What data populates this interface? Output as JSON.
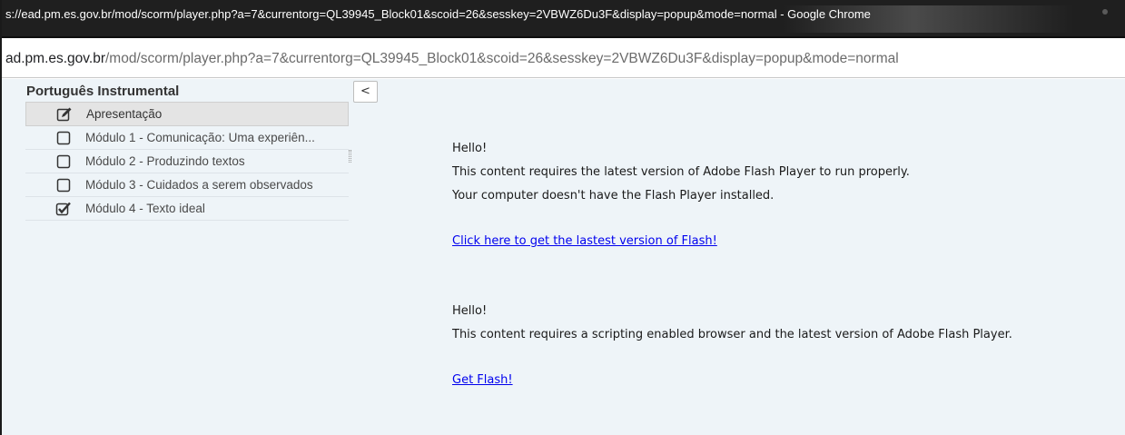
{
  "window": {
    "title": "s://ead.pm.es.gov.br/mod/scorm/player.php?a=7&currentorg=QL39945_Block01&scoid=26&sesskey=2VBWZ6Du3F&display=popup&mode=normal - Google Chrome"
  },
  "address_bar": {
    "host": "ad.pm.es.gov.br",
    "path": "/mod/scorm/player.php?a=7&currentorg=QL39945_Block01&scoid=26&sesskey=2VBWZ6Du3F&display=popup&mode=normal"
  },
  "toc": {
    "title": "Português Instrumental",
    "collapse_label": "<",
    "items": [
      {
        "label": "Apresentação",
        "icon": "edit-icon"
      },
      {
        "label": "Módulo 1 - Comunicação: Uma experiên...",
        "icon": "checkbox-empty-icon"
      },
      {
        "label": "Módulo 2 - Produzindo textos",
        "icon": "checkbox-empty-icon"
      },
      {
        "label": "Módulo 3 - Cuidados a serem observados",
        "icon": "checkbox-empty-icon"
      },
      {
        "label": "Módulo 4 - Texto ideal",
        "icon": "checkbox-checked-icon"
      }
    ]
  },
  "content": {
    "block1": {
      "greeting": "Hello!",
      "line1": "This content requires the latest version of Adobe Flash Player to run properly.",
      "line2": "Your computer doesn't have the Flash Player installed.",
      "link": "Click here to get the lastest version of Flash!"
    },
    "block2": {
      "greeting": "Hello!",
      "line1": "This content requires a scripting enabled browser and the latest version of Adobe Flash Player.",
      "link": "Get Flash!"
    }
  },
  "colors": {
    "titlebar": "#1f1f1f",
    "page_background": "#eef4f8",
    "link": "#0000ee"
  }
}
